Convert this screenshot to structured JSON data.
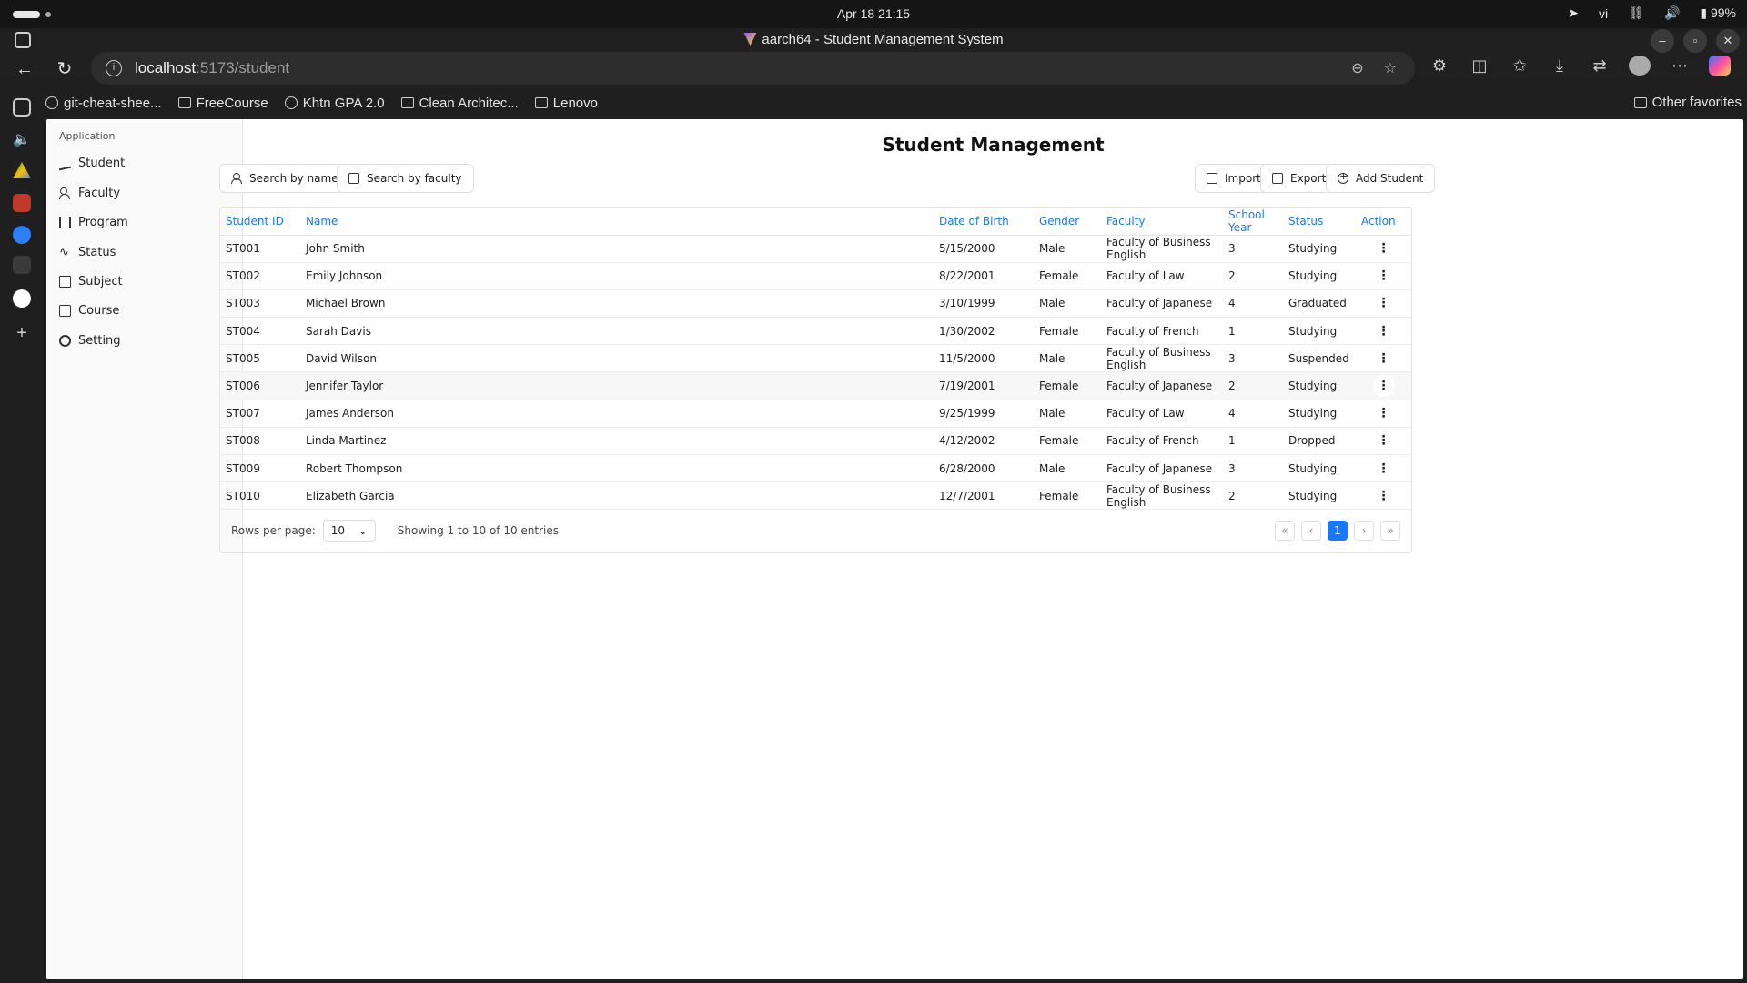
{
  "os": {
    "clock": "Apr 18  21:15",
    "lang": "vi",
    "battery": "99%"
  },
  "browser": {
    "window_title": "aarch64 - Student Management System",
    "url_host": "localhost",
    "url_path": ":5173/student",
    "bookmarks": [
      "git-cheat-shee...",
      "FreeCourse",
      "Khtn GPA 2.0",
      "Clean Architec...",
      "Lenovo"
    ],
    "other_favorites": "Other favorites"
  },
  "sidebar": {
    "group": "Application",
    "items": [
      {
        "label": "Student",
        "icon": "graduation-cap-icon"
      },
      {
        "label": "Faculty",
        "icon": "users-icon"
      },
      {
        "label": "Program",
        "icon": "library-icon"
      },
      {
        "label": "Status",
        "icon": "activity-icon"
      },
      {
        "label": "Subject",
        "icon": "bookmark-icon"
      },
      {
        "label": "Course",
        "icon": "file-text-icon"
      },
      {
        "label": "Setting",
        "icon": "gear-icon"
      }
    ]
  },
  "page": {
    "title": "Student Management",
    "search_name": "Search by name",
    "search_faculty": "Search by faculty",
    "import": "Import",
    "export": "Export",
    "add": "Add Student"
  },
  "table": {
    "headers": [
      "Student ID",
      "Name",
      "Date of Birth",
      "Gender",
      "Faculty",
      "School Year",
      "Status",
      "Action"
    ],
    "rows": [
      [
        "ST001",
        "John Smith",
        "5/15/2000",
        "Male",
        "Faculty of Business English",
        "3",
        "Studying"
      ],
      [
        "ST002",
        "Emily Johnson",
        "8/22/2001",
        "Female",
        "Faculty of Law",
        "2",
        "Studying"
      ],
      [
        "ST003",
        "Michael Brown",
        "3/10/1999",
        "Male",
        "Faculty of Japanese",
        "4",
        "Graduated"
      ],
      [
        "ST004",
        "Sarah Davis",
        "1/30/2002",
        "Female",
        "Faculty of French",
        "1",
        "Studying"
      ],
      [
        "ST005",
        "David Wilson",
        "11/5/2000",
        "Male",
        "Faculty of Business English",
        "3",
        "Suspended"
      ],
      [
        "ST006",
        "Jennifer Taylor",
        "7/19/2001",
        "Female",
        "Faculty of Japanese",
        "2",
        "Studying"
      ],
      [
        "ST007",
        "James Anderson",
        "9/25/1999",
        "Male",
        "Faculty of Law",
        "4",
        "Studying"
      ],
      [
        "ST008",
        "Linda Martinez",
        "4/12/2002",
        "Female",
        "Faculty of French",
        "1",
        "Dropped"
      ],
      [
        "ST009",
        "Robert Thompson",
        "6/28/2000",
        "Male",
        "Faculty of Japanese",
        "3",
        "Studying"
      ],
      [
        "ST010",
        "Elizabeth Garcia",
        "12/7/2001",
        "Female",
        "Faculty of Business English",
        "2",
        "Studying"
      ]
    ]
  },
  "pagination": {
    "rows_label": "Rows per page:",
    "rows_value": "10",
    "summary": "Showing 1 to 10 of 10 entries",
    "current_page": "1"
  },
  "colors": {
    "accent": "#1677ff"
  }
}
